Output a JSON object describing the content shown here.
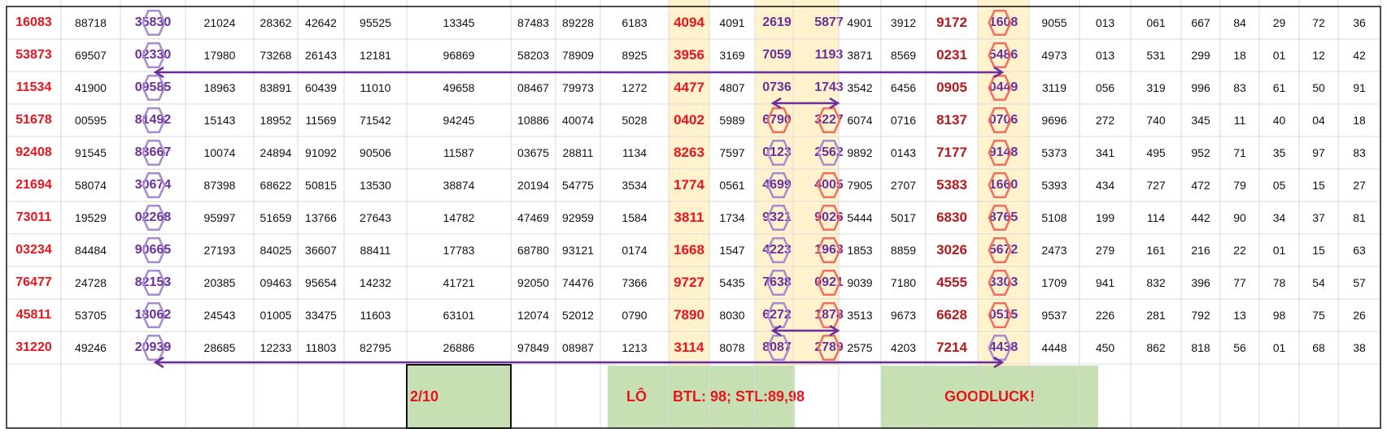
{
  "rows": [
    [
      "16083",
      "88718",
      "35830",
      "21024",
      "28362",
      "42642",
      "95525",
      "13345",
      "87483",
      "89228",
      "6183",
      "4094",
      "4091",
      "2619",
      "5877",
      "4901",
      "3912",
      "9172",
      "1608",
      "9055",
      "013",
      "061",
      "667",
      "84",
      "29",
      "72",
      "36"
    ],
    [
      "53873",
      "69507",
      "02330",
      "17980",
      "73268",
      "26143",
      "12181",
      "96869",
      "58203",
      "78909",
      "8925",
      "3956",
      "3169",
      "7059",
      "1193",
      "3871",
      "8569",
      "0231",
      "5486",
      "4973",
      "013",
      "531",
      "299",
      "18",
      "01",
      "12",
      "42"
    ],
    [
      "11534",
      "41900",
      "09585",
      "18963",
      "83891",
      "60439",
      "11010",
      "49658",
      "08467",
      "79973",
      "1272",
      "4477",
      "4807",
      "0736",
      "1743",
      "3542",
      "6456",
      "0905",
      "0449",
      "3119",
      "056",
      "319",
      "996",
      "83",
      "61",
      "50",
      "91"
    ],
    [
      "51678",
      "00595",
      "81492",
      "15143",
      "18952",
      "11569",
      "71542",
      "94245",
      "10886",
      "40074",
      "5028",
      "0402",
      "5989",
      "6790",
      "3227",
      "6074",
      "0716",
      "8137",
      "0706",
      "9696",
      "272",
      "740",
      "345",
      "11",
      "40",
      "04",
      "18"
    ],
    [
      "92408",
      "91545",
      "83667",
      "10074",
      "24894",
      "91092",
      "90506",
      "11587",
      "03675",
      "28811",
      "1134",
      "8263",
      "7597",
      "0123",
      "2562",
      "9892",
      "0143",
      "7177",
      "9148",
      "5373",
      "341",
      "495",
      "952",
      "71",
      "35",
      "97",
      "83"
    ],
    [
      "21694",
      "58074",
      "30674",
      "87398",
      "68622",
      "50815",
      "13530",
      "38874",
      "20194",
      "54775",
      "3534",
      "1774",
      "0561",
      "4699",
      "4005",
      "7905",
      "2707",
      "5383",
      "1660",
      "5393",
      "434",
      "727",
      "472",
      "79",
      "05",
      "15",
      "27"
    ],
    [
      "73011",
      "19529",
      "02268",
      "95997",
      "51659",
      "13766",
      "27643",
      "14782",
      "47469",
      "92959",
      "1584",
      "3811",
      "1734",
      "9321",
      "9026",
      "5444",
      "5017",
      "6830",
      "8765",
      "5108",
      "199",
      "114",
      "442",
      "90",
      "34",
      "37",
      "81"
    ],
    [
      "03234",
      "84484",
      "90665",
      "27193",
      "84025",
      "36607",
      "88411",
      "17783",
      "68780",
      "93121",
      "0174",
      "1668",
      "1547",
      "4223",
      "1963",
      "1853",
      "8859",
      "3026",
      "5672",
      "2473",
      "279",
      "161",
      "216",
      "22",
      "01",
      "15",
      "63"
    ],
    [
      "76477",
      "24728",
      "82153",
      "20385",
      "09463",
      "95654",
      "14232",
      "41721",
      "92050",
      "74476",
      "7366",
      "9727",
      "5435",
      "7638",
      "0921",
      "9039",
      "7180",
      "4555",
      "3303",
      "1709",
      "941",
      "832",
      "396",
      "77",
      "78",
      "54",
      "57"
    ],
    [
      "45811",
      "53705",
      "13062",
      "24543",
      "01005",
      "33475",
      "11603",
      "63101",
      "12074",
      "52012",
      "0790",
      "7890",
      "8030",
      "6272",
      "1878",
      "3513",
      "9673",
      "6628",
      "0515",
      "9537",
      "226",
      "281",
      "792",
      "13",
      "98",
      "75",
      "26"
    ],
    [
      "31220",
      "49246",
      "20939",
      "28685",
      "12233",
      "11803",
      "82795",
      "26886",
      "97849",
      "08987",
      "1213",
      "3114",
      "8078",
      "8087",
      "2789",
      "2575",
      "4203",
      "7214",
      "4438",
      "4448",
      "450",
      "862",
      "818",
      "56",
      "01",
      "68",
      "38"
    ]
  ],
  "footer": {
    "date": "2/10",
    "lo_label": "LÔ",
    "btl_text": "BTL: 98; STL:89,98",
    "goodluck": "GOODLUCK!"
  },
  "colors": {
    "red": "#e8141e",
    "purple": "#6a2f9b",
    "dark_red": "#b11a1e",
    "shade": "#fff2cc",
    "green": "#c6e0b4",
    "hex_purple": "#a78bd0",
    "hex_red": "#f07060",
    "arrow": "#6a2f9b"
  }
}
